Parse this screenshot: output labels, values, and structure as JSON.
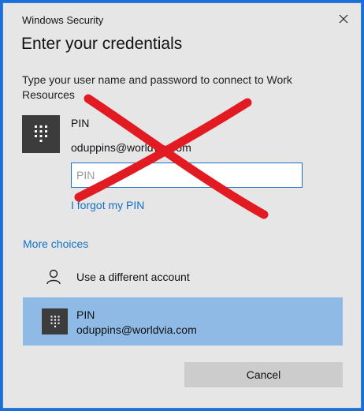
{
  "window": {
    "title": "Windows Security",
    "close_icon": "close-icon"
  },
  "heading": "Enter your credentials",
  "instruction": "Type your user name and password to connect to Work Resources",
  "credential": {
    "icon": "keypad-icon",
    "name": "PIN",
    "user": "oduppins@worldvia.com",
    "pin_placeholder": "PIN",
    "pin_value": "",
    "forgot_link": "I forgot my PIN"
  },
  "more_choices": {
    "label": "More choices",
    "items": [
      {
        "icon": "person-icon",
        "label": "Use a different account"
      },
      {
        "icon": "keypad-icon",
        "name": "PIN",
        "user": "oduppins@worldvia.com",
        "selected": true
      }
    ]
  },
  "buttons": {
    "cancel": "Cancel"
  },
  "overlay": {
    "icon": "red-x-cross",
    "color": "#e21b23"
  },
  "colors": {
    "accent_link": "#1470c4",
    "selected_bg": "#8fbae6",
    "tile_bg": "#3c3c3c",
    "dialog_bg": "#e6e6e6"
  }
}
